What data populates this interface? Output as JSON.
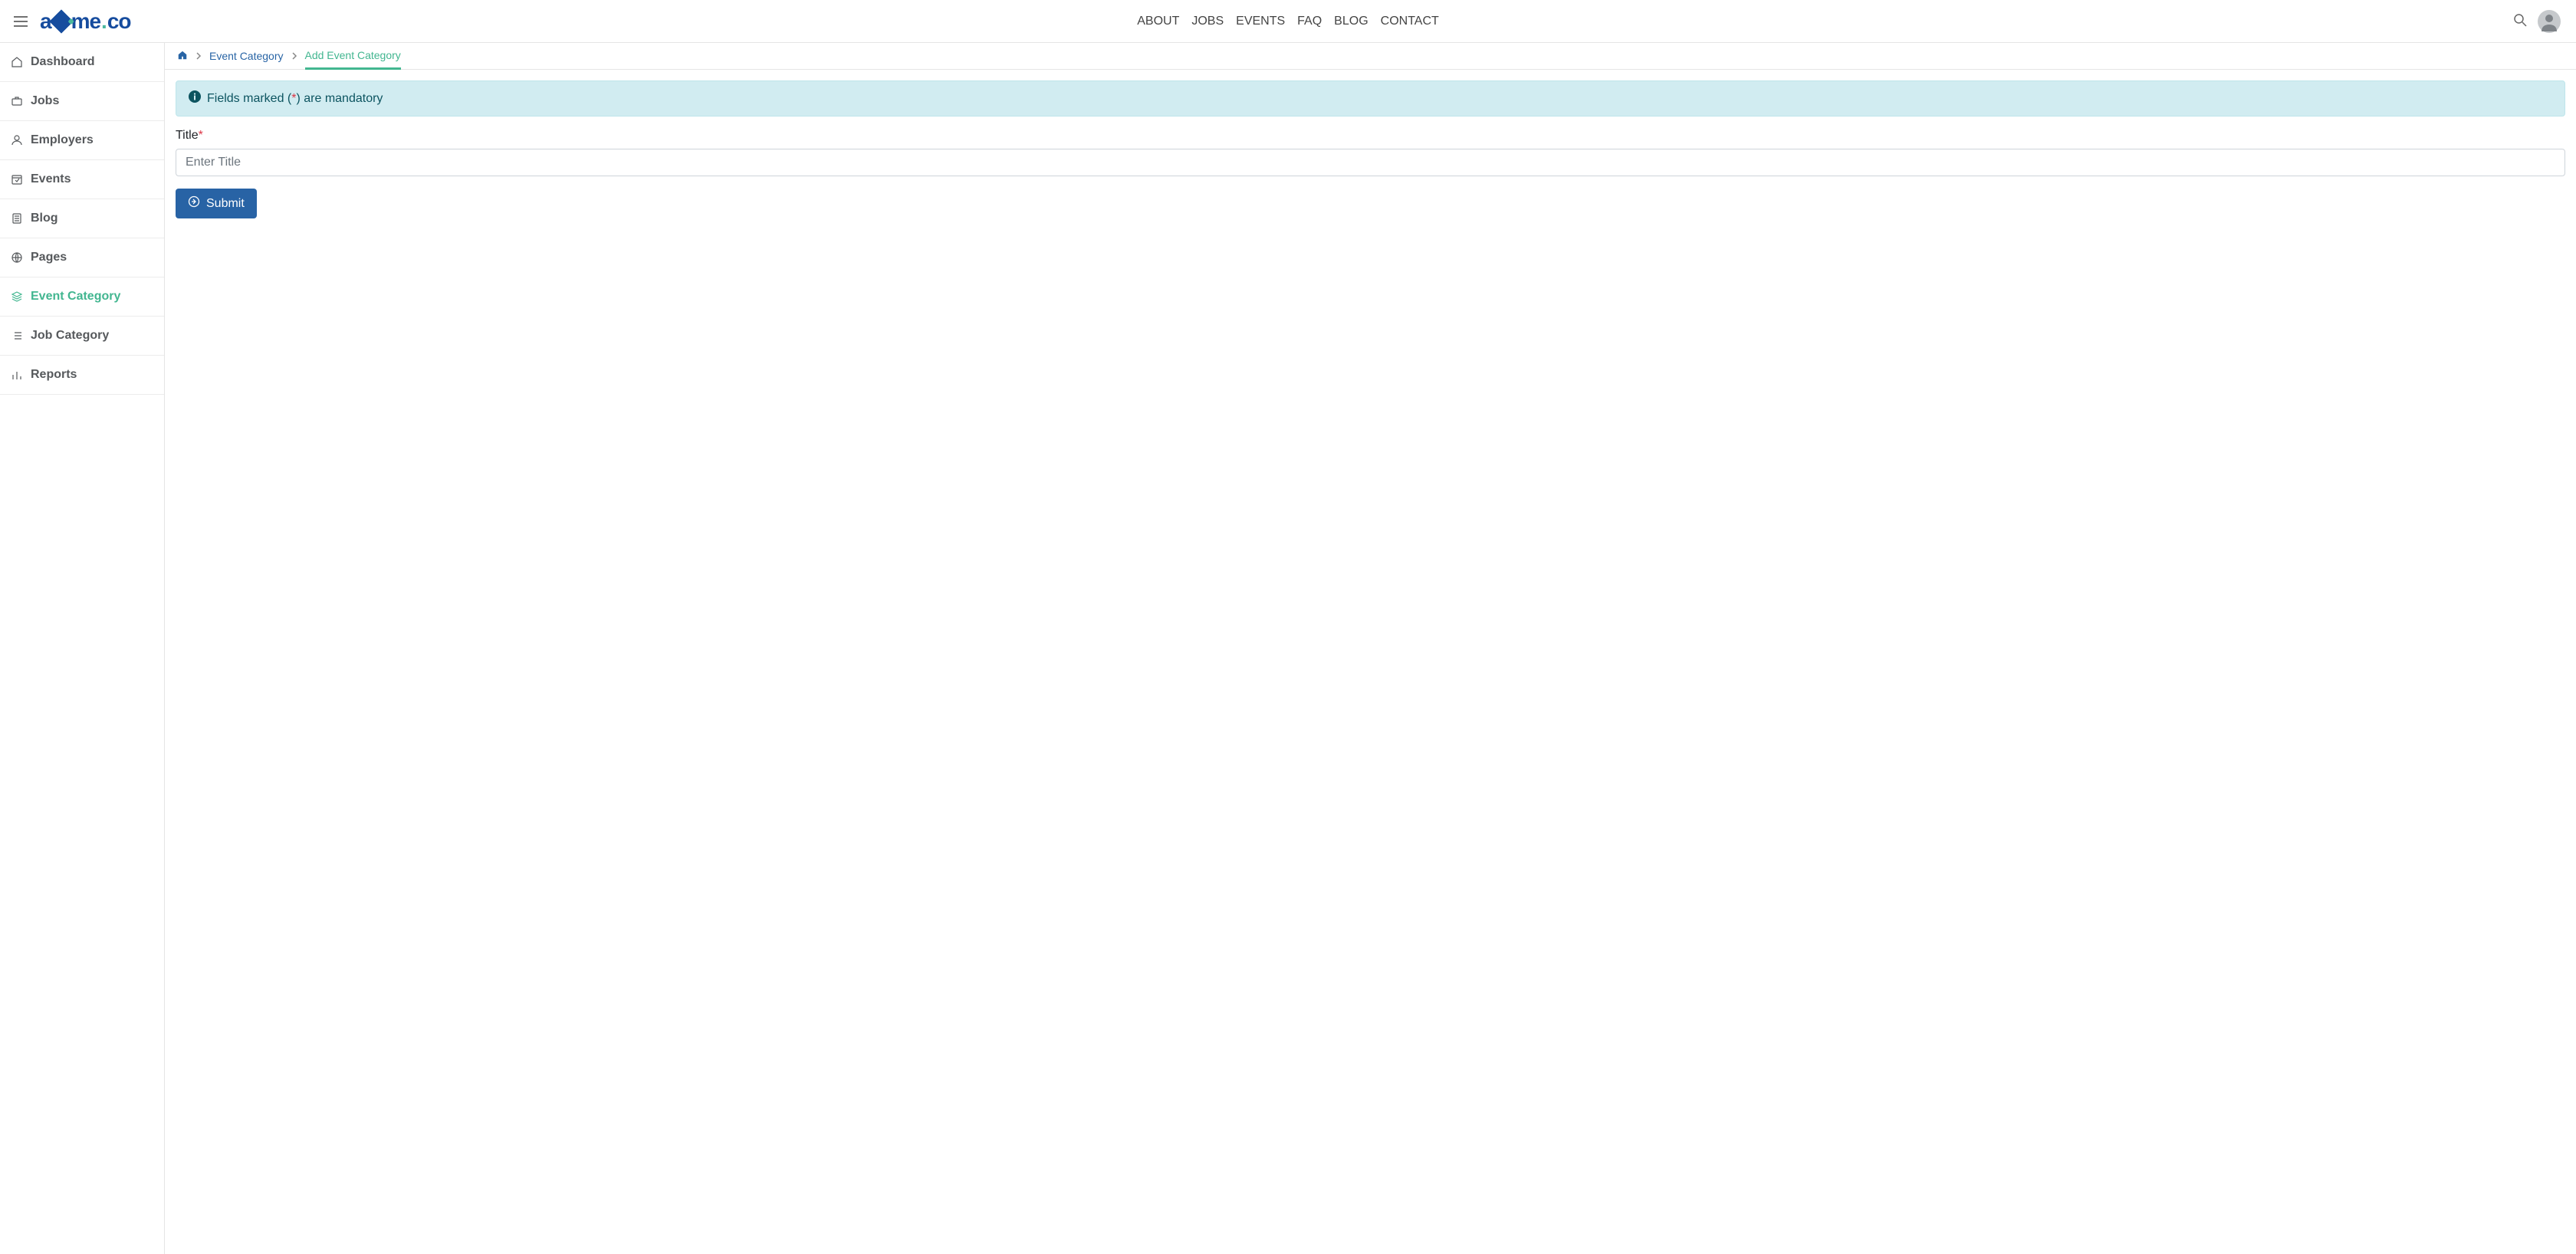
{
  "header": {
    "logo_part1": "a",
    "logo_part2": "me",
    "logo_dot": ".",
    "logo_part3": "co",
    "nav": [
      "ABOUT",
      "JOBS",
      "EVENTS",
      "FAQ",
      "BLOG",
      "CONTACT"
    ]
  },
  "sidebar": {
    "items": [
      {
        "label": "Dashboard",
        "icon": "home-icon",
        "active": false
      },
      {
        "label": "Jobs",
        "icon": "briefcase-icon",
        "active": false
      },
      {
        "label": "Employers",
        "icon": "person-icon",
        "active": false
      },
      {
        "label": "Events",
        "icon": "calendar-icon",
        "active": false
      },
      {
        "label": "Blog",
        "icon": "book-icon",
        "active": false
      },
      {
        "label": "Pages",
        "icon": "globe-icon",
        "active": false
      },
      {
        "label": "Event Category",
        "icon": "layers-icon",
        "active": true
      },
      {
        "label": "Job Category",
        "icon": "list-icon",
        "active": false
      },
      {
        "label": "Reports",
        "icon": "chart-icon",
        "active": false
      }
    ]
  },
  "breadcrumb": {
    "parent": "Event Category",
    "current": "Add Event Category"
  },
  "alert": {
    "prefix": "Fields marked (",
    "star": "*",
    "suffix": ") are mandatory"
  },
  "form": {
    "title_label": "Title",
    "title_placeholder": "Enter Title",
    "submit_label": "Submit"
  }
}
